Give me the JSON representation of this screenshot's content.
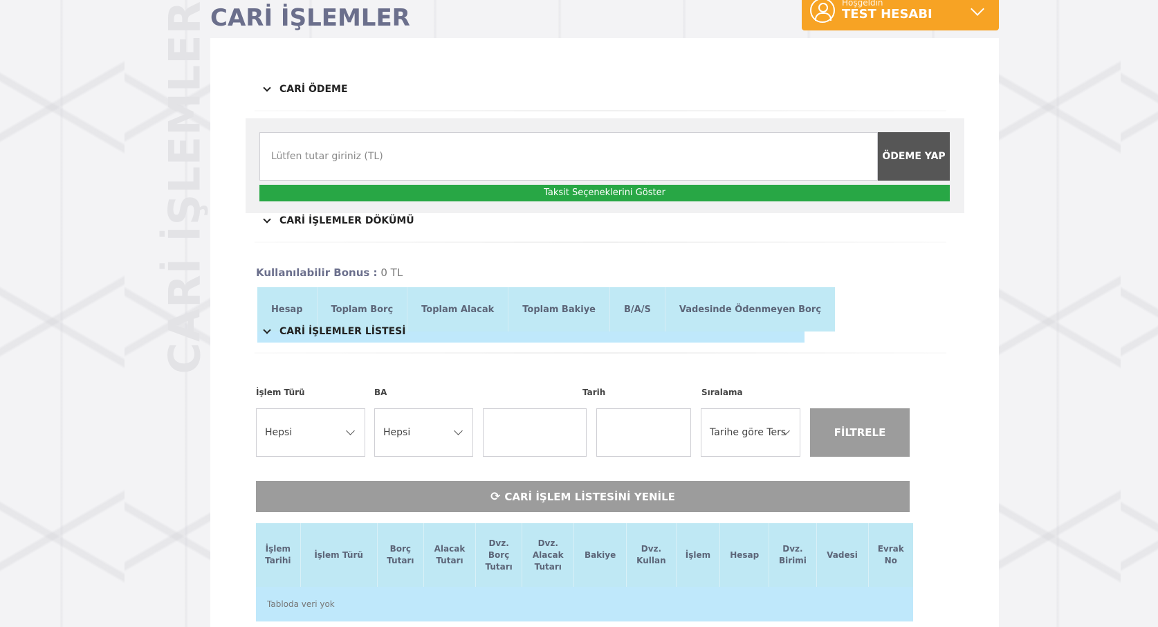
{
  "page": {
    "title": "CARİ İŞLEMLER",
    "vertical_watermark": "CARİ İŞLEMLER"
  },
  "user": {
    "greeting": "Hoşgeldin",
    "name": "TEST HESABI"
  },
  "sections": {
    "payment": "CARİ ÖDEME",
    "statement": "CARİ İŞLEMLER DÖKÜMÜ",
    "list": "CARİ İŞLEMLER LİSTESİ"
  },
  "payment": {
    "placeholder": "Lütfen tutar giriniz (TL)",
    "pay_button": "ÖDEME YAP",
    "installments": "Taksit Seçeneklerini Göster"
  },
  "bonus": {
    "label": "Kullanılabilir Bonus :",
    "value": "0 TL"
  },
  "summary_columns": [
    "Hesap",
    "Toplam Borç",
    "Toplam Alacak",
    "Toplam Bakiye",
    "B/A/S",
    "Vadesinde Ödenmeyen Borç"
  ],
  "filters": {
    "labels": {
      "type": "İşlem Türü",
      "ba": "BA",
      "date": "Tarih",
      "sort": "Sıralama"
    },
    "type_value": "Hepsi",
    "ba_value": "Hepsi",
    "sort_value": "Tarihe göre Ters",
    "filter_button": "FİLTRELE"
  },
  "refresh_button": "CARİ İŞLEM LİSTESİNİ YENİLE",
  "list_columns": [
    [
      "İşlem",
      "Tarihi"
    ],
    [
      "İşlem Türü"
    ],
    [
      "Borç",
      "Tutarı"
    ],
    [
      "Alacak",
      "Tutarı"
    ],
    [
      "Dvz.",
      "Borç",
      "Tutarı"
    ],
    [
      "Dvz.",
      "Alacak",
      "Tutarı"
    ],
    [
      "Bakiye"
    ],
    [
      "Dvz.",
      "Kullan"
    ],
    [
      "İşlem"
    ],
    [
      "Hesap"
    ],
    [
      "Dvz.",
      "Birimi"
    ],
    [
      "Vadesi"
    ],
    [
      "Evrak",
      "No"
    ]
  ],
  "empty_message": "Tabloda veri yok",
  "colors": {
    "accent": "#f7a324",
    "green": "#28a745",
    "table_header": "#c0e9f5"
  }
}
